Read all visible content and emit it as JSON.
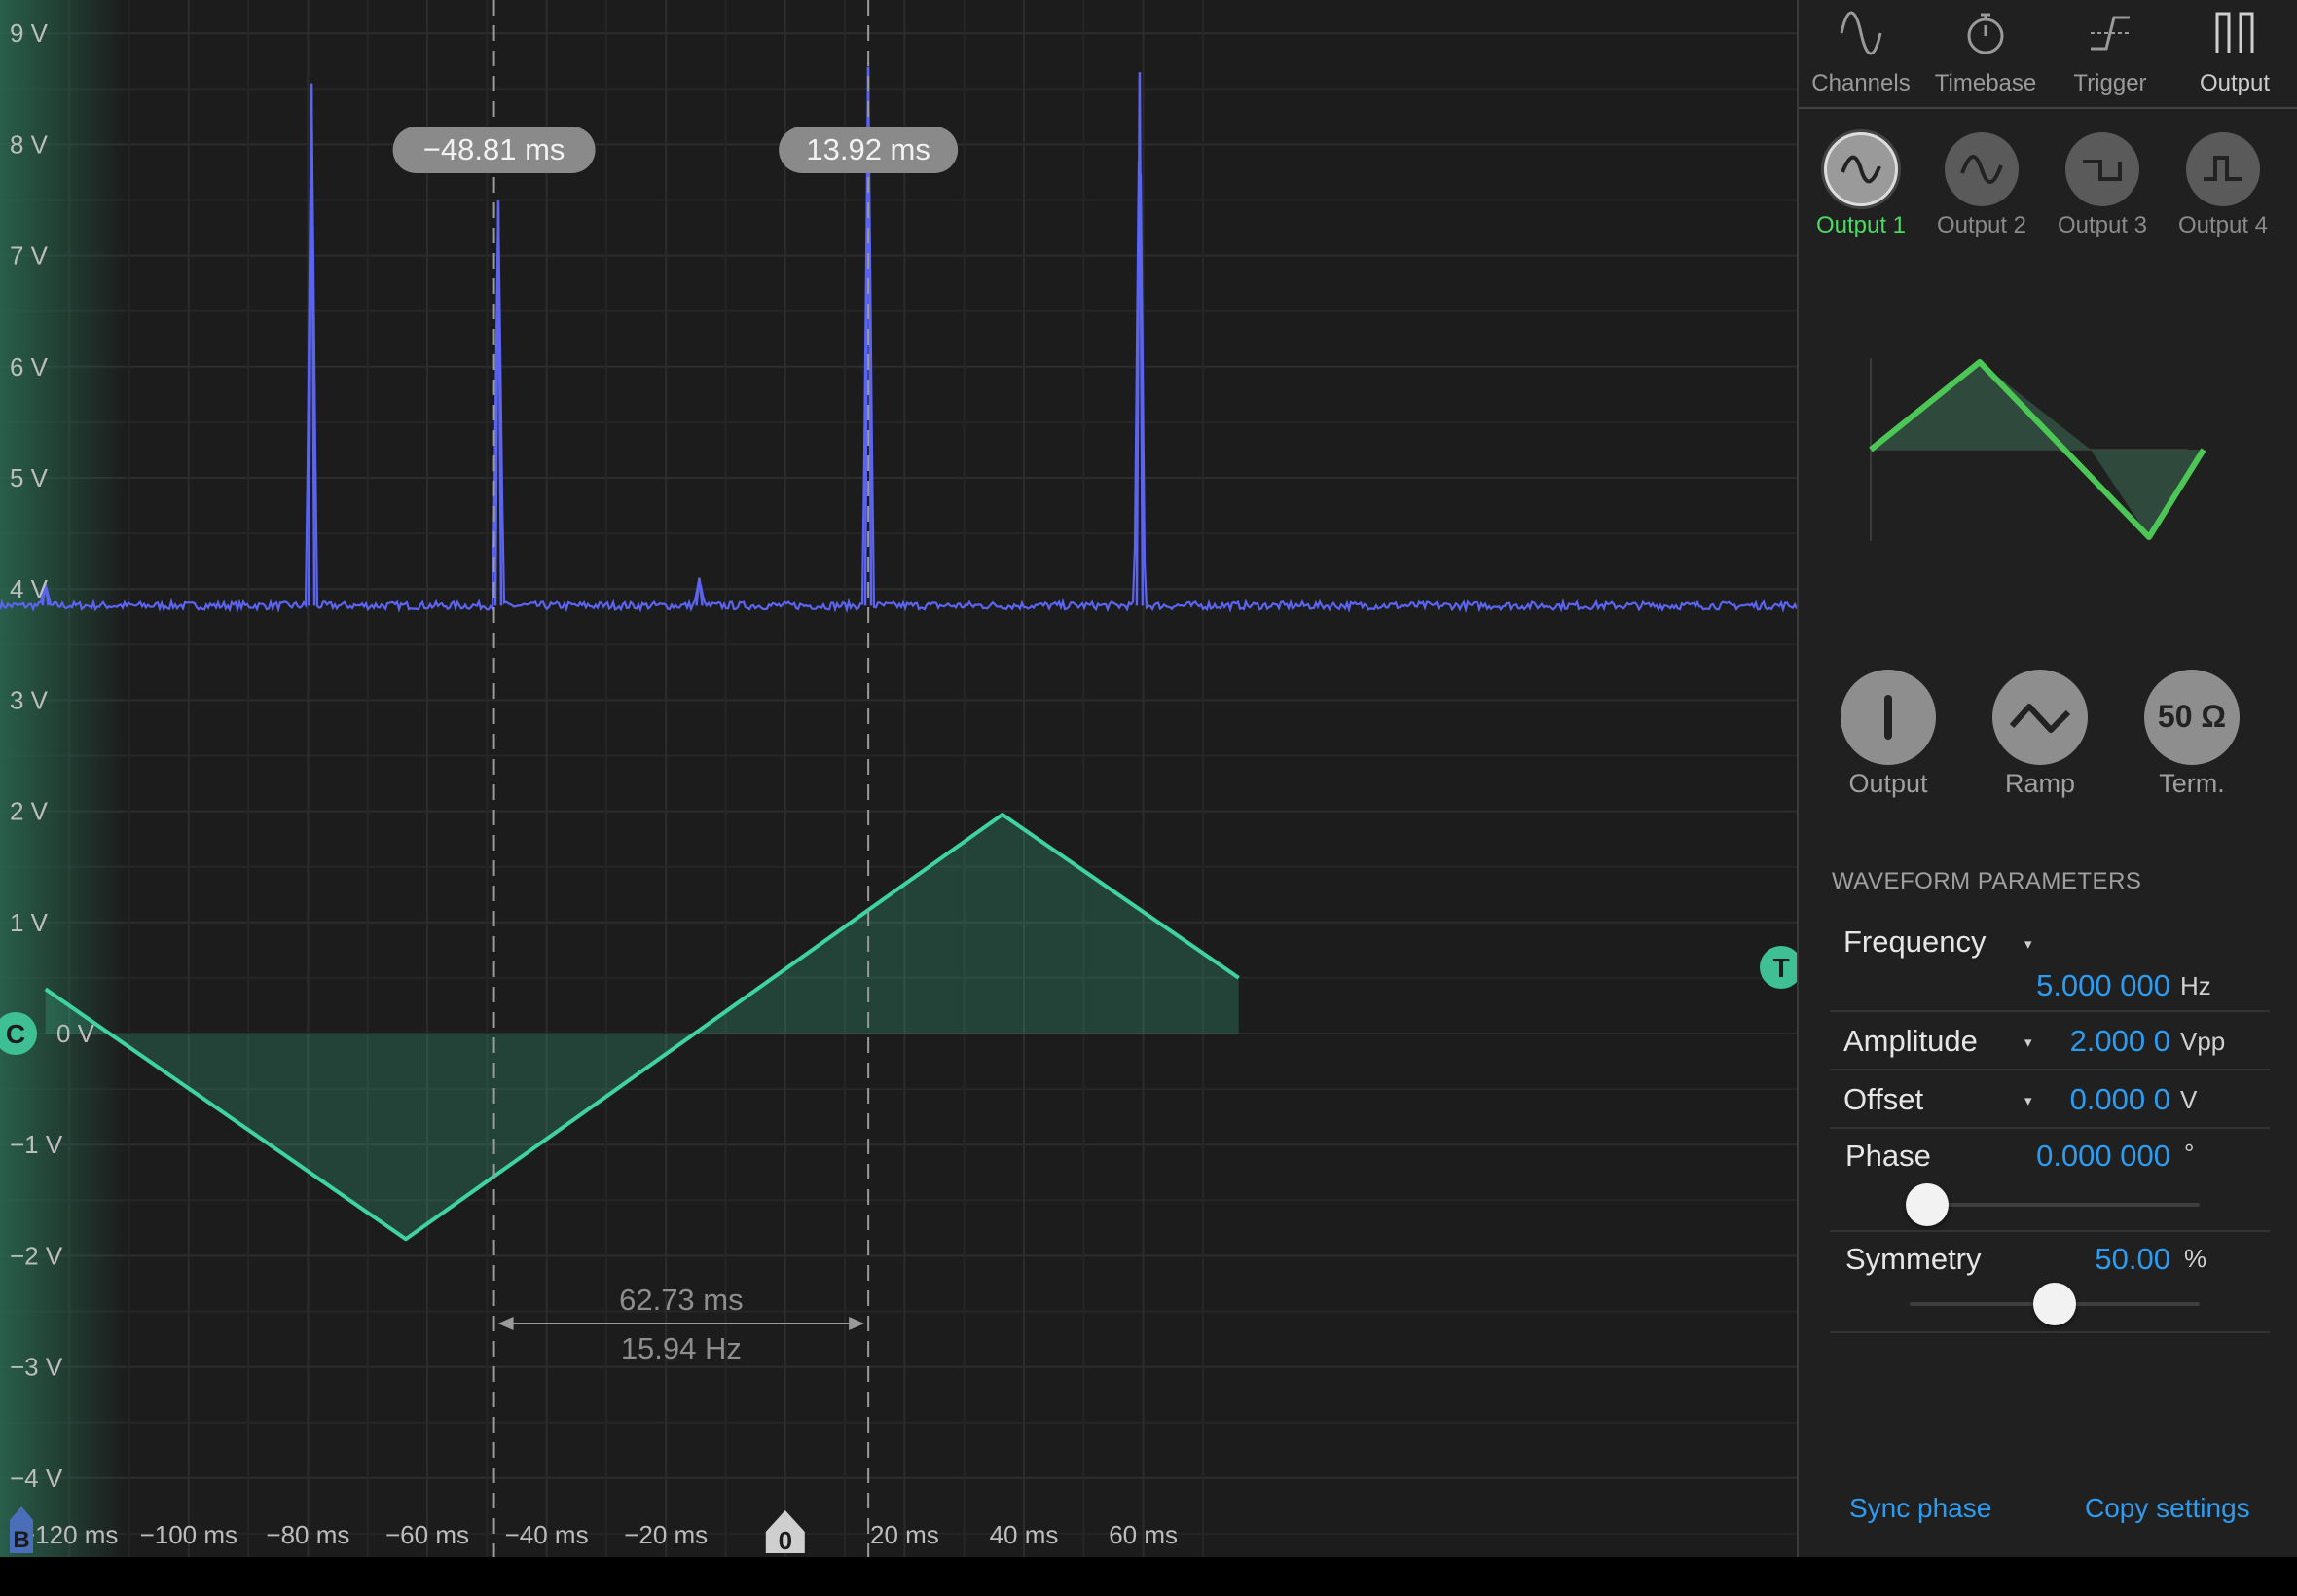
{
  "tabs": [
    {
      "label": "Channels",
      "icon": "sine-wave-icon"
    },
    {
      "label": "Timebase",
      "icon": "stopwatch-icon"
    },
    {
      "label": "Trigger",
      "icon": "trigger-edge-icon"
    },
    {
      "label": "Output",
      "icon": "pulse-output-icon"
    }
  ],
  "outputs": [
    {
      "label": "Output 1",
      "icon": "sine-wave-icon",
      "active": true
    },
    {
      "label": "Output 2",
      "icon": "sine-wave-icon"
    },
    {
      "label": "Output 3",
      "icon": "square-wave-icon"
    },
    {
      "label": "Output 4",
      "icon": "pulse-wave-icon"
    }
  ],
  "controls": {
    "output_label": "Output",
    "ramp_label": "Ramp",
    "term_label": "Term.",
    "term_value": "50 Ω"
  },
  "section_title": "WAVEFORM PARAMETERS",
  "params": {
    "frequency": {
      "label": "Frequency",
      "value": "5.000 000",
      "unit": "Hz"
    },
    "amplitude": {
      "label": "Amplitude",
      "value": "2.000 0",
      "unit": "Vpp"
    },
    "offset": {
      "label": "Offset",
      "value": "0.000 0",
      "unit": "V"
    },
    "phase": {
      "label": "Phase",
      "value": "0.000 000",
      "unit": "°",
      "slider_fraction": 0.06
    },
    "symmetry": {
      "label": "Symmetry",
      "value": "50.00",
      "unit": "%",
      "slider_fraction": 0.5
    }
  },
  "footer": {
    "sync": "Sync phase",
    "copy": "Copy settings"
  },
  "scope": {
    "cursor_a_label": "−48.81 ms",
    "cursor_b_label": "13.92 ms",
    "delta_time": "62.73 ms",
    "delta_freq": "15.94 Hz",
    "marker_c": "C",
    "marker_t": "T",
    "marker_b": "B",
    "marker_zero": "0",
    "y_ticks": [
      "9 V",
      "8 V",
      "7 V",
      "6 V",
      "5 V",
      "4 V",
      "3 V",
      "2 V",
      "1 V",
      "0 V",
      "−1 V",
      "−2 V",
      "−3 V",
      "−4 V"
    ],
    "x_ticks": [
      "−120 ms",
      "−100 ms",
      "−80 ms",
      "−60 ms",
      "−40 ms",
      "−20 ms",
      "20 ms",
      "40 ms",
      "60 ms"
    ]
  },
  "chart_data": {
    "type": "line",
    "xlabel": "",
    "ylabel": "",
    "xlim": [
      -124,
      76
    ],
    "ylim": [
      -4.55,
      9.25
    ],
    "grid": true,
    "colors": {
      "channel_blue": "#5a64f0",
      "ramp_green": "#3fd3a1",
      "output_active": "#4cd964",
      "value_blue": "#2d9cf0"
    },
    "series": [
      {
        "x": [
          -124,
          -63.6,
          36.4,
          76
        ],
        "y": [
          0.4,
          -1.85,
          1.97,
          0.5
        ]
      },
      {
        "baseline": 3.85,
        "spikes": [
          {
            "x": -124,
            "y": 4.05
          },
          {
            "x": -79.4,
            "y": 8.55
          },
          {
            "x": -48.1,
            "y": 7.5
          },
          {
            "x": -14.4,
            "y": 4.1
          },
          {
            "x": 13.9,
            "y": 8.7
          },
          {
            "x": 59.4,
            "y": 8.65
          }
        ]
      }
    ],
    "cursors_ms": [
      -48.81,
      13.92
    ]
  }
}
